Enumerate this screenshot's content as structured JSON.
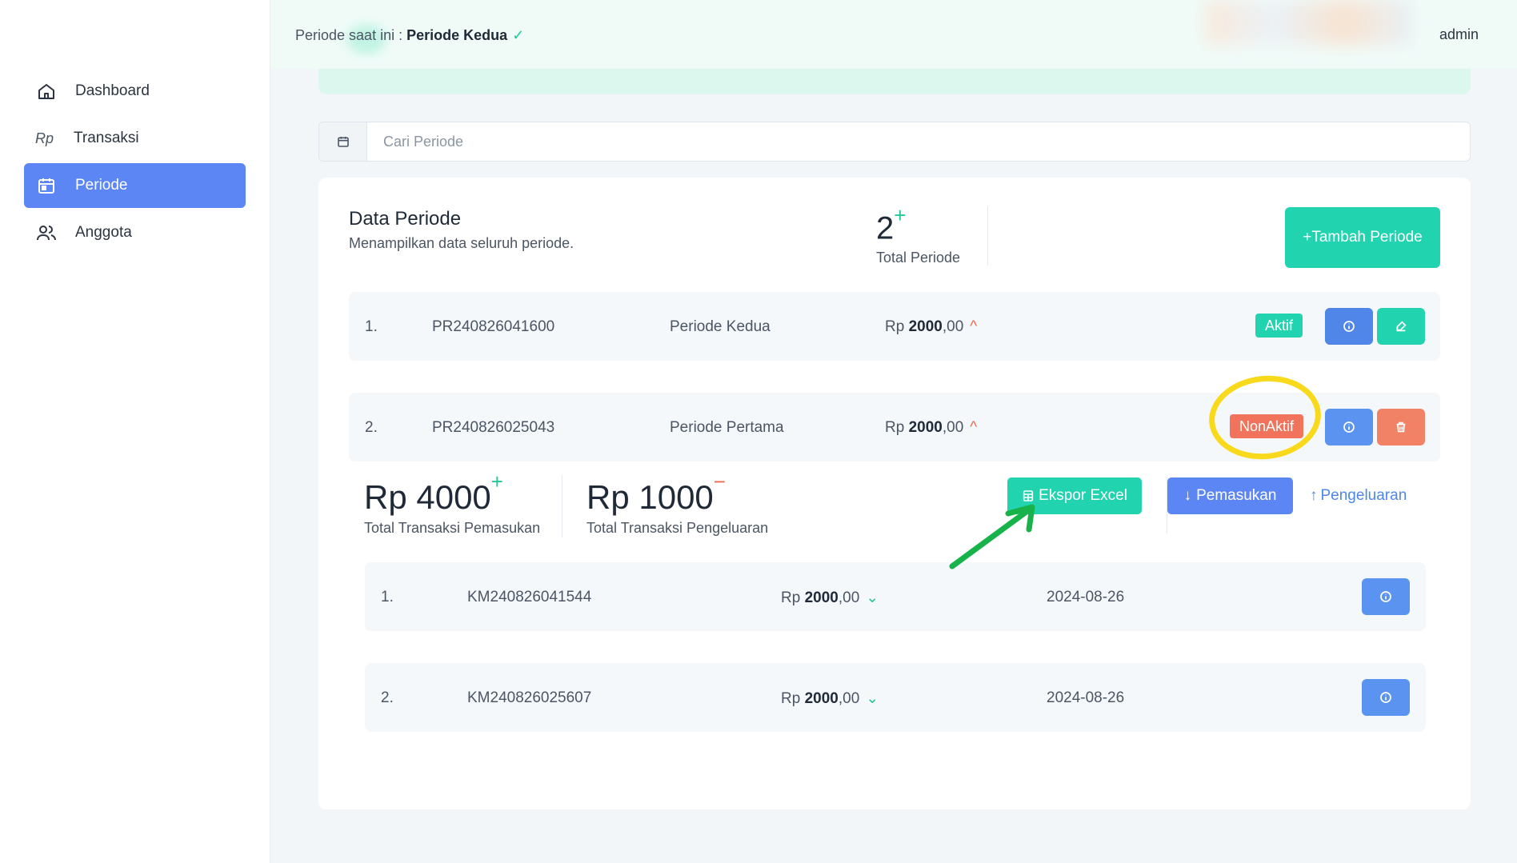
{
  "header": {
    "period_prefix": "Periode saat ini :",
    "period_name": "Periode Kedua",
    "user": "admin"
  },
  "sidebar": {
    "items": [
      {
        "label": "Dashboard",
        "icon": "home-icon"
      },
      {
        "label": "Transaksi",
        "icon": "rupiah-icon",
        "icon_text": "Rp"
      },
      {
        "label": "Periode",
        "icon": "calendar-icon",
        "active": true
      },
      {
        "label": "Anggota",
        "icon": "users-icon"
      }
    ]
  },
  "search": {
    "placeholder": "Cari Periode"
  },
  "card": {
    "title": "Data Periode",
    "subtitle": "Menampilkan data seluruh periode.",
    "total_value": "2",
    "total_plus": "+",
    "total_label": "Total Periode",
    "add_button": "+Tambah Periode"
  },
  "periods": [
    {
      "no": "1.",
      "code": "PR240826041600",
      "name": "Periode Kedua",
      "currency": "Rp",
      "amount": "2000",
      "decimals": ",00",
      "status": "Aktif"
    },
    {
      "no": "2.",
      "code": "PR240826025043",
      "name": "Periode Pertama",
      "currency": "Rp",
      "amount": "2000",
      "decimals": ",00",
      "status": "NonAktif"
    }
  ],
  "summary": {
    "income": "Rp 4000",
    "income_sign": "+",
    "income_label": "Total Transaksi Pemasukan",
    "expense": "Rp 1000",
    "expense_sign": "−",
    "expense_label": "Total Transaksi Pengeluaran",
    "export_button": "Ekspor Excel",
    "income_tab": "Pemasukan",
    "expense_tab": "Pengeluaran"
  },
  "transactions": [
    {
      "no": "1.",
      "code": "KM240826041544",
      "currency": "Rp",
      "amount": "2000",
      "decimals": ",00",
      "date": "2024-08-26"
    },
    {
      "no": "2.",
      "code": "KM240826025607",
      "currency": "Rp",
      "amount": "2000",
      "decimals": ",00",
      "date": "2024-08-26"
    }
  ],
  "colors": {
    "primary": "#5b86f4",
    "success": "#22d3b0",
    "danger": "#f2735c",
    "annotation_circle": "#f8d91b",
    "annotation_arrow": "#17b34a"
  }
}
